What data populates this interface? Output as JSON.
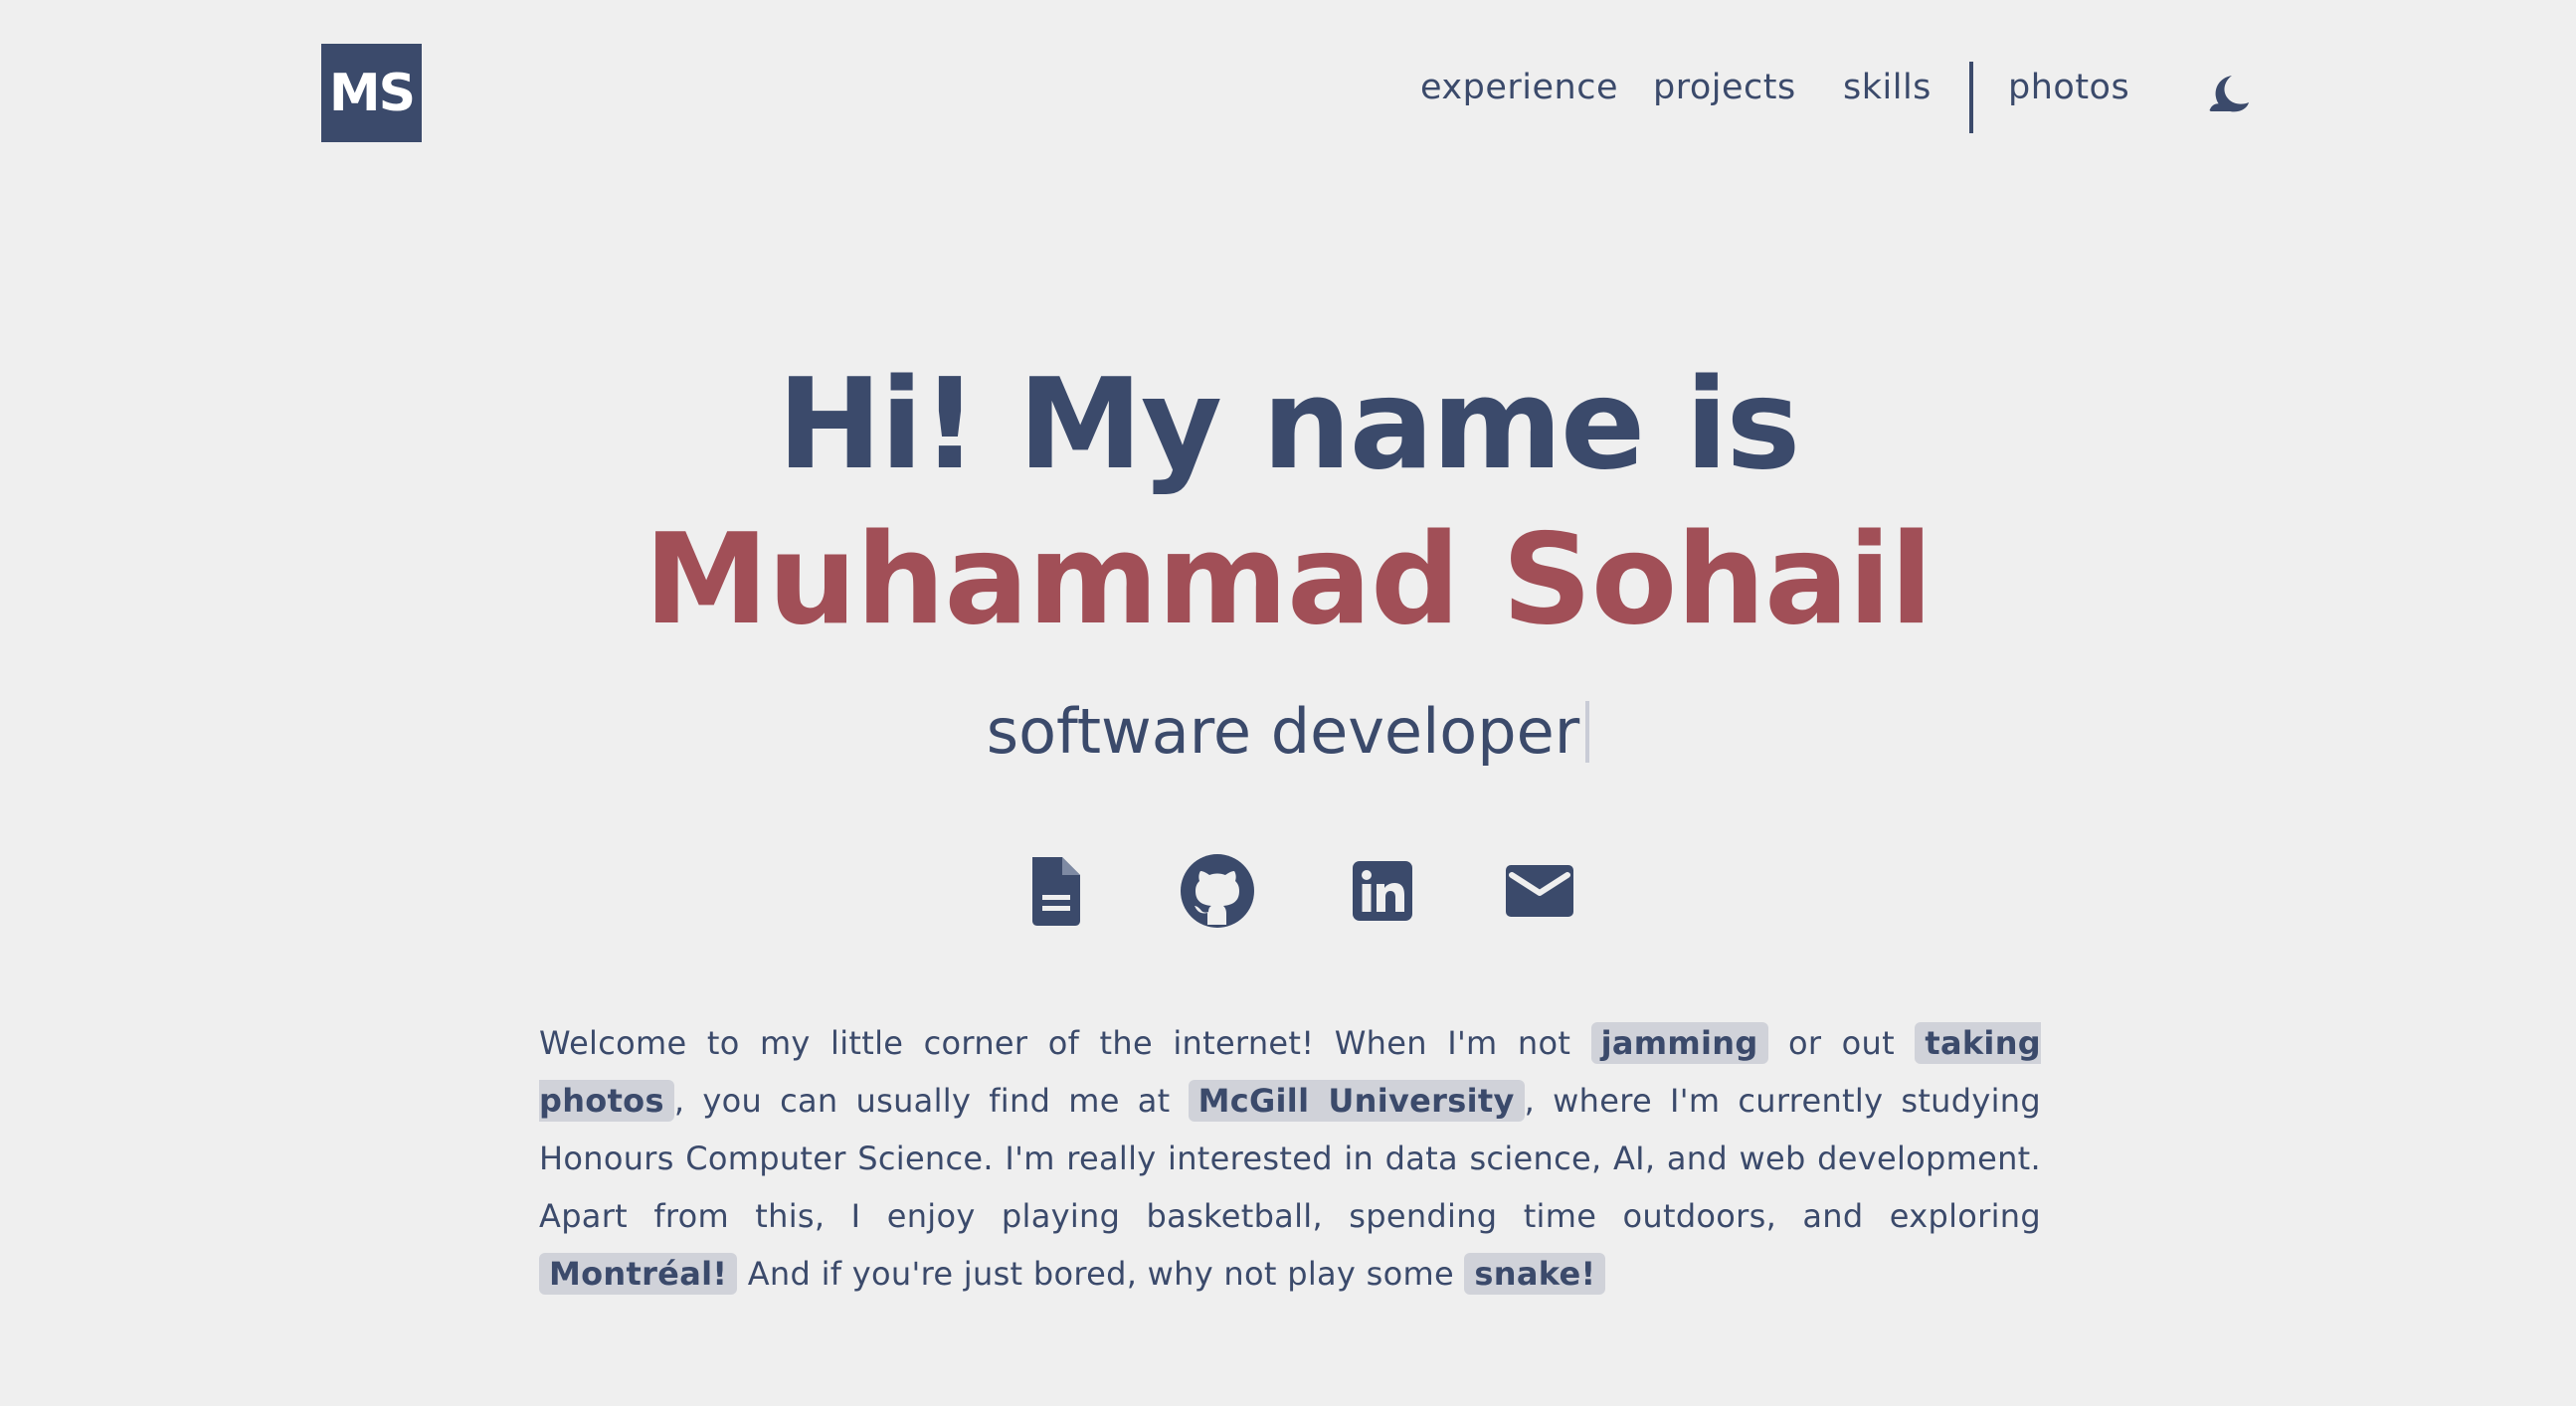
{
  "header": {
    "logo_text": "MS",
    "nav": {
      "experience": "experience",
      "projects": "projects",
      "skills": "skills",
      "photos": "photos"
    },
    "theme_toggle_icon": "moon-icon"
  },
  "hero": {
    "greeting": "Hi! My name is",
    "name": "Muhammad Sohail",
    "role": "software developer"
  },
  "social": {
    "icons": [
      "resume-document-icon",
      "github-icon",
      "linkedin-icon",
      "email-icon"
    ]
  },
  "intro": {
    "p1": "Welcome to my little corner of the internet! When I'm not ",
    "hl1": "jamming",
    "p2": " or out ",
    "hl2": "taking photos",
    "p3": ", you can usually find me at ",
    "hl3": "McGill University",
    "p4": ", where I'm currently studying Honours Computer Science. I'm really interested in data science, AI, and web development. Apart from this, I enjoy playing basketball, spending time outdoors, and exploring ",
    "hl4": "Montréal!",
    "p5": " And if you're just bored, why not play some ",
    "hl5": "snake!"
  },
  "colors": {
    "primary": "#3b4a6b",
    "accent": "#a14f57",
    "background": "#efefef",
    "highlight": "#d0d2d9"
  }
}
